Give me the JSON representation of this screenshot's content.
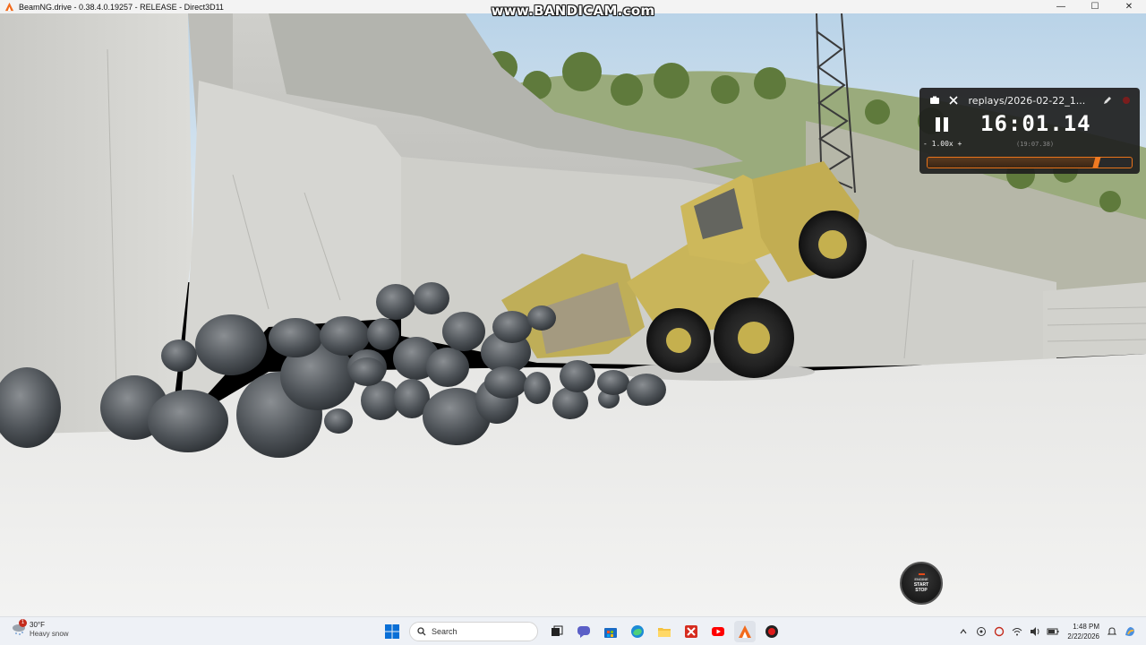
{
  "window": {
    "title": "BeamNG.drive - 0.38.4.0.19257 - RELEASE - Direct3D11",
    "minimize": "—",
    "maximize": "☐",
    "close": "✕"
  },
  "watermark": "www.BANDICAM.com",
  "replay": {
    "filename": "replays/2026-02-22_1...",
    "time": "16:01.14",
    "speed": "- 1.00x +",
    "total": "(19:07.38)",
    "progress": 0.83
  },
  "engine": {
    "top": "ENGINE",
    "line1": "START",
    "line2": "STOP"
  },
  "taskbar": {
    "weather": {
      "temp": "30°F",
      "condition": "Heavy snow",
      "badge": "1"
    },
    "search_placeholder": "Search",
    "clock": {
      "time": "1:48 PM",
      "date": "2/22/2026"
    }
  },
  "icons": {
    "app": "beamng-icon",
    "weather": "snow-cloud-icon",
    "start": "windows-start-icon",
    "search": "search-icon",
    "taskbar_apps": [
      "task-view-icon",
      "chat-icon",
      "store-icon",
      "edge-icon",
      "file-explorer-icon",
      "xmind-icon",
      "youtube-icon",
      "beamng-icon",
      "bandicam-record-icon"
    ],
    "tray": [
      "chevron-up-icon",
      "network-icon",
      "sync-icon",
      "wifi-icon",
      "volume-icon",
      "battery-icon",
      "notification-icon",
      "copilot-icon"
    ]
  }
}
